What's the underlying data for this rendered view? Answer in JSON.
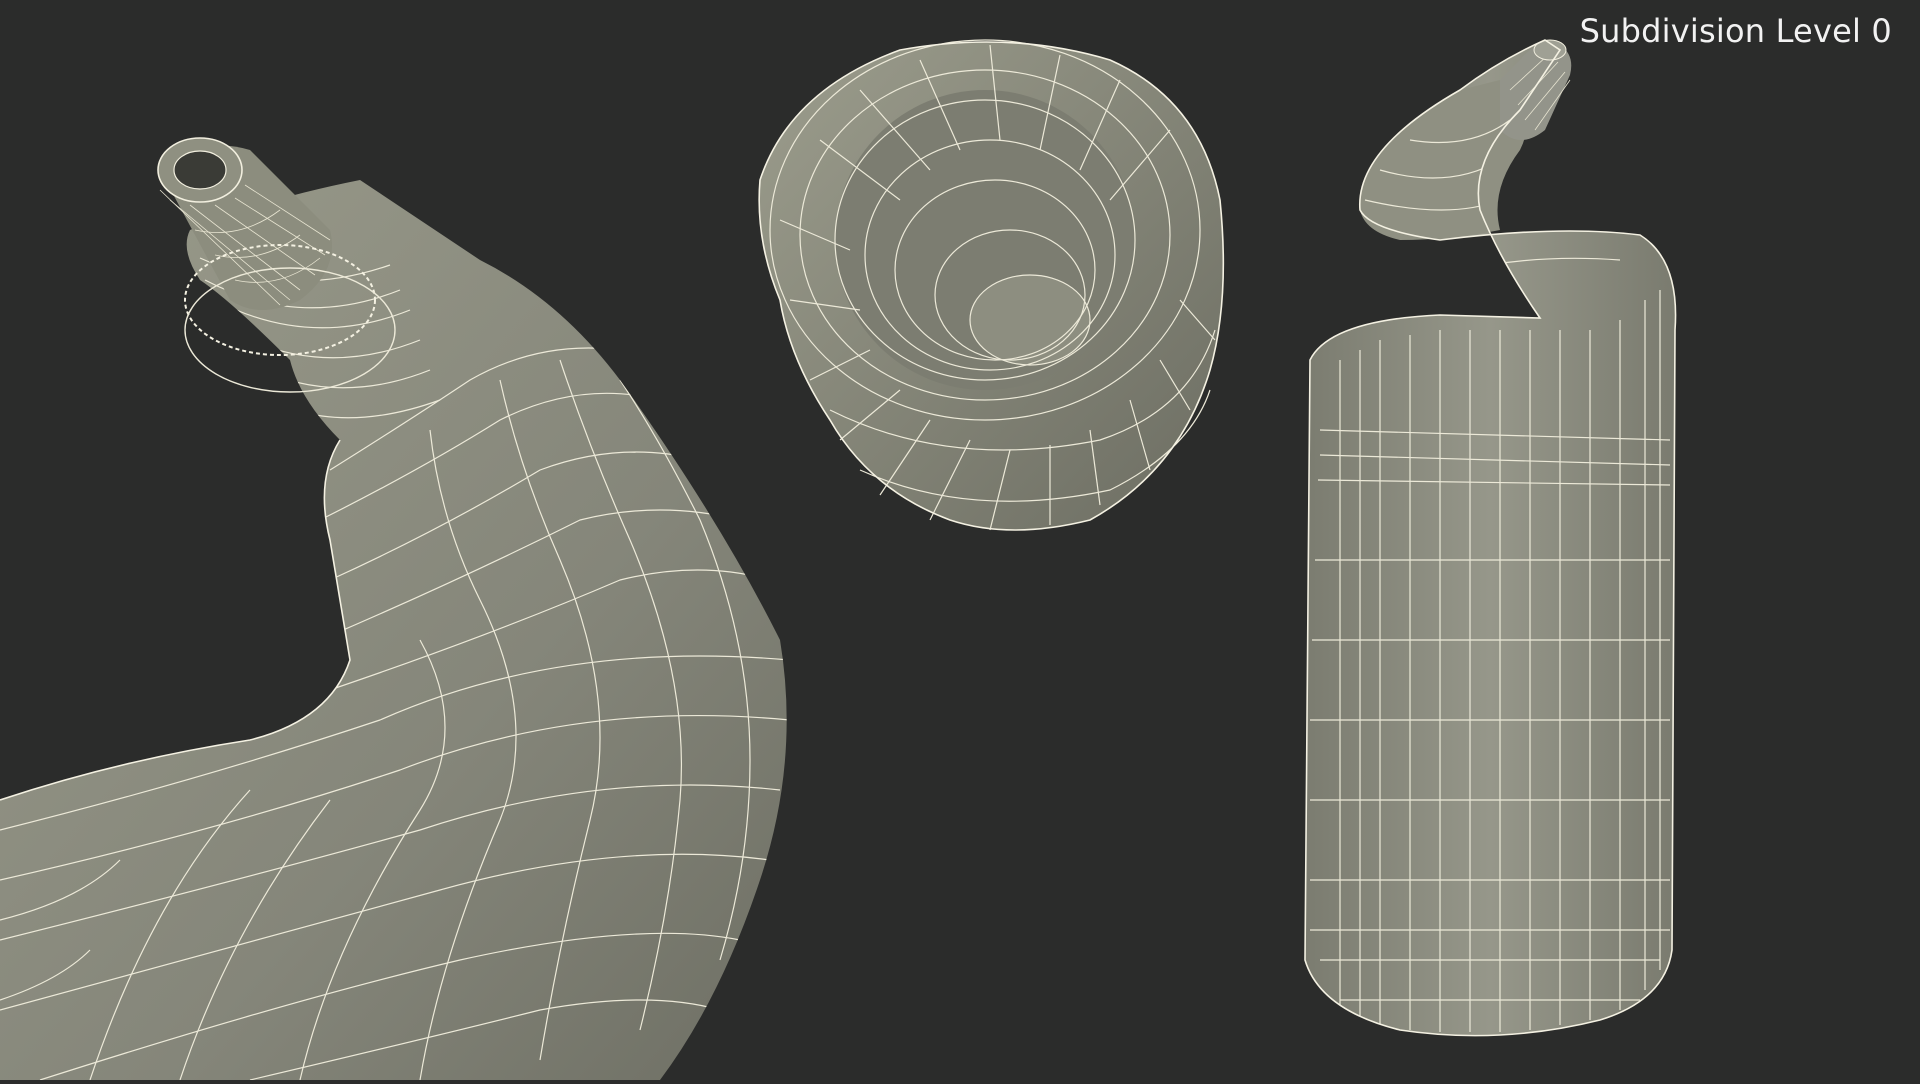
{
  "viewport": {
    "overlay_label": "Subdivision Level 0",
    "background_color": "#2b2c2b",
    "mesh_fill_color": "#8a8b7b",
    "wire_color": "#ece9d8"
  },
  "models": [
    {
      "name": "bottle-neck-closeup"
    },
    {
      "name": "bottle-cap"
    },
    {
      "name": "toilet-cleaner-bottle"
    }
  ]
}
